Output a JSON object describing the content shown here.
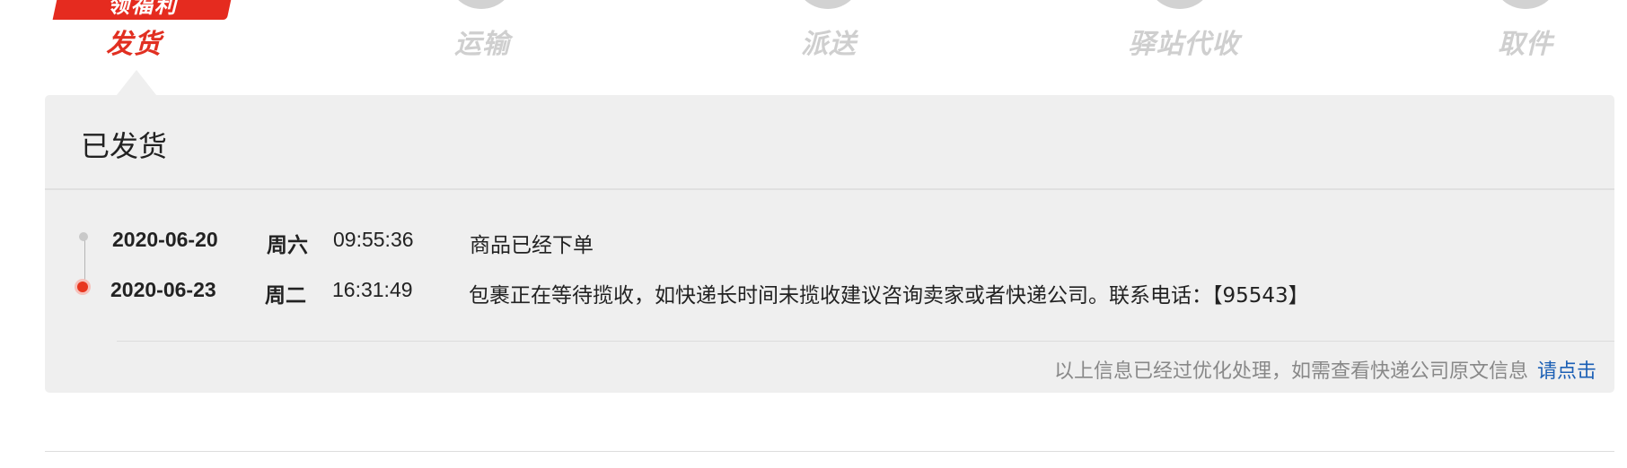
{
  "progress": {
    "brand_logo_text": "领福利",
    "steps": [
      {
        "label": "发货",
        "active": true
      },
      {
        "label": "运输",
        "active": false
      },
      {
        "label": "派送",
        "active": false
      },
      {
        "label": "驿站代收",
        "active": false
      },
      {
        "label": "取件",
        "active": false
      }
    ]
  },
  "panel": {
    "title": "已发货",
    "events": [
      {
        "date": "2020-06-20",
        "weekday": "周六",
        "time": "09:55:36",
        "description": "商品已经下单"
      },
      {
        "date": "2020-06-23",
        "weekday": "周二",
        "time": "16:31:49",
        "description": "包裹正在等待揽收，如快递长时间未揽收建议咨询卖家或者快递公司。联系电话：【95543】"
      }
    ],
    "note_text": "以上信息已经过优化处理，如需查看快递公司原文信息",
    "note_link": "请点击"
  },
  "colors": {
    "accent": "#e12f21",
    "link": "#1b5fb5",
    "panel_bg": "#efefef"
  }
}
